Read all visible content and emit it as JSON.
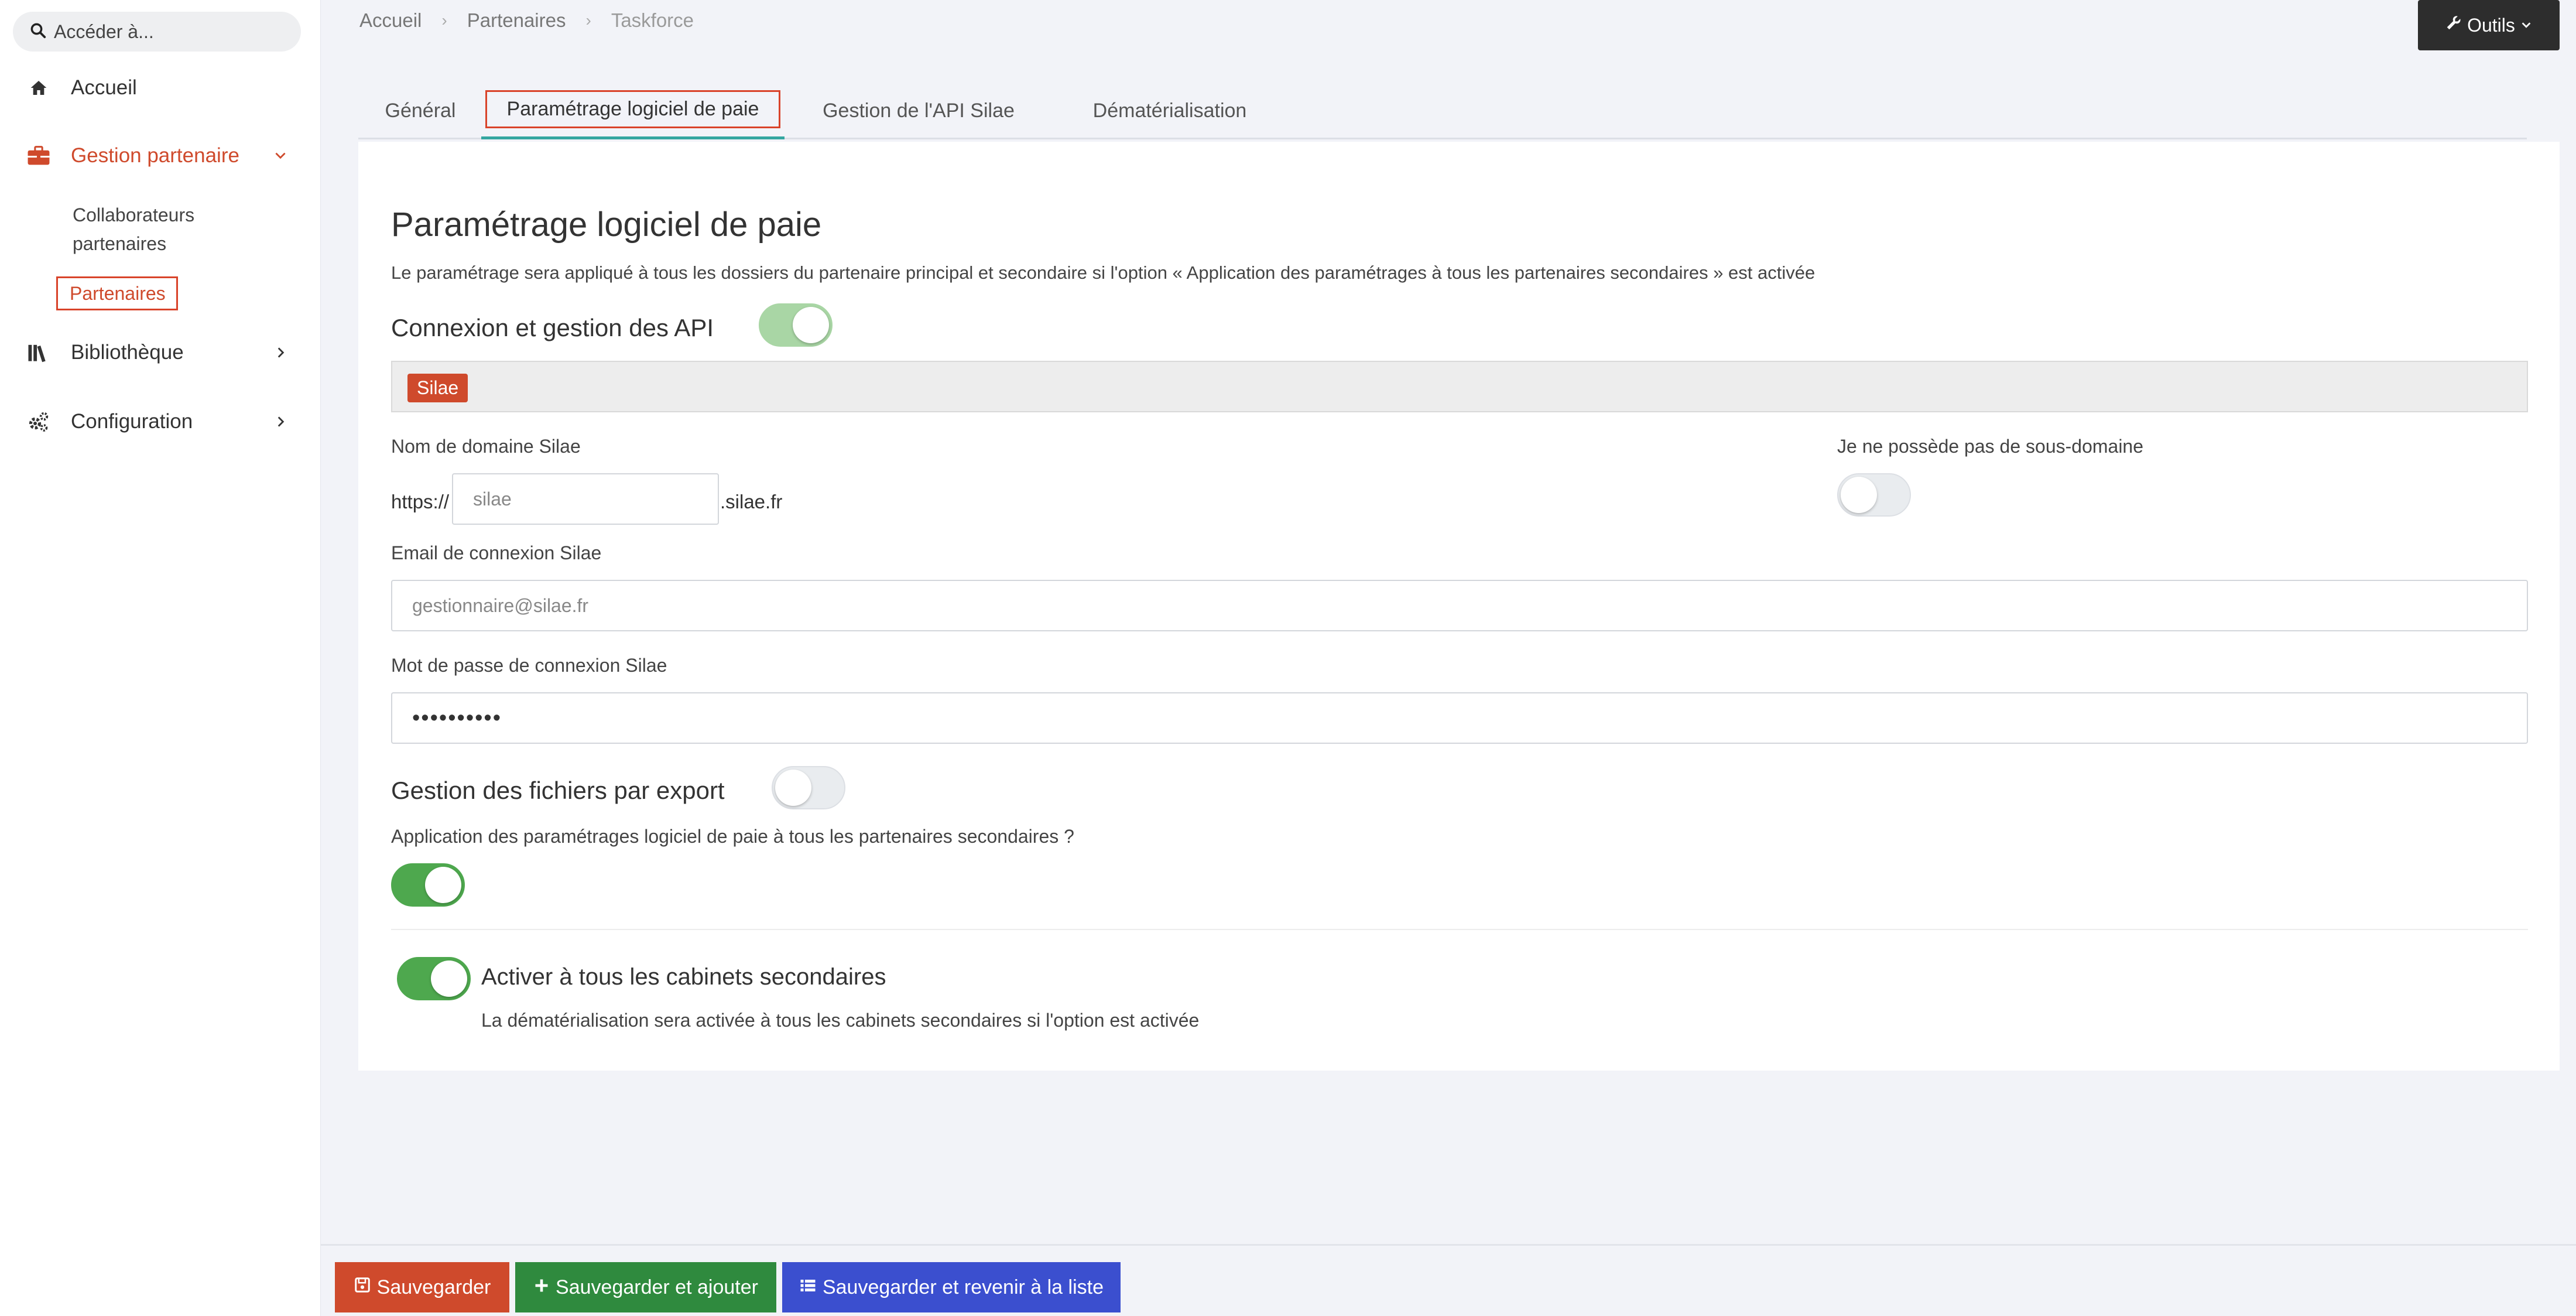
{
  "search": {
    "placeholder": "Accéder à..."
  },
  "sidebar": {
    "items": [
      {
        "label": "Accueil",
        "icon": "home-icon"
      },
      {
        "label": "Gestion partenaire",
        "icon": "briefcase-icon",
        "active": true
      },
      {
        "label": "Bibliothèque",
        "icon": "books-icon"
      },
      {
        "label": "Configuration",
        "icon": "cogs-icon"
      }
    ],
    "subitems": [
      {
        "label_line1": "Collaborateurs",
        "label_line2": "partenaires"
      },
      {
        "label": "Partenaires",
        "selected": true
      }
    ]
  },
  "breadcrumb": [
    "Accueil",
    "Partenaires",
    "Taskforce"
  ],
  "tools": {
    "label": "Outils"
  },
  "tabs": [
    {
      "label": "Général"
    },
    {
      "label": "Paramétrage logiciel de paie",
      "active": true
    },
    {
      "label": "Gestion de l'API Silae"
    },
    {
      "label": "Dématérialisation"
    }
  ],
  "main": {
    "title": "Paramétrage logiciel de paie",
    "description": "Le paramétrage sera appliqué à tous les dossiers du partenaire principal et secondaire si l'option « Application des paramétrages à tous les partenaires secondaires » est activée",
    "api_section": {
      "label": "Connexion et gestion des API",
      "enabled": true,
      "tag": "Silae"
    },
    "domain": {
      "label": "Nom de domaine Silae",
      "prefix": "https://",
      "placeholder": "silae",
      "suffix": ".silae.fr"
    },
    "no_subdomain": {
      "label": "Je ne possède pas de sous-domaine",
      "enabled": false
    },
    "email": {
      "label": "Email de connexion Silae",
      "placeholder": "gestionnaire@silae.fr"
    },
    "password": {
      "label": "Mot de passe de connexion Silae",
      "value": "••••••••••"
    },
    "export_section": {
      "label": "Gestion des fichiers par export",
      "enabled": false
    },
    "apply_all": {
      "label": "Application des paramétrages logiciel de paie à tous les partenaires secondaires ?",
      "enabled": true
    },
    "cabinets": {
      "label": "Activer à tous les cabinets secondaires",
      "note": "La dématérialisation sera activée à tous les cabinets secondaires si l'option est activée",
      "enabled": true
    }
  },
  "footer": {
    "save": "Sauvegarder",
    "save_add": "Sauvegarder et ajouter",
    "save_list": "Sauvegarder et revenir à la liste"
  },
  "colors": {
    "accent": "#cf4a2c",
    "toggle_on": "#4ea84e",
    "tab_underline": "#34a6a0",
    "save_add": "#2f8a3e",
    "save_list": "#3b4fcf"
  }
}
